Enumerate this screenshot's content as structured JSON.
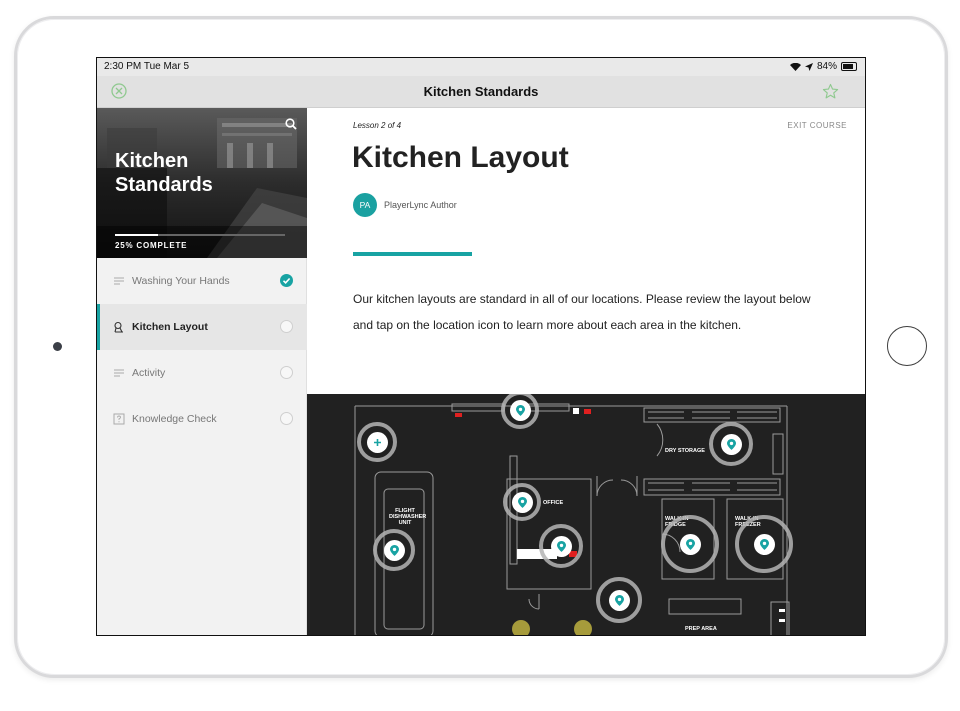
{
  "status_bar": {
    "time": "2:30 PM  Tue Mar 5",
    "battery": "84%"
  },
  "navbar": {
    "title": "Kitchen Standards",
    "close_icon": "close-circle-icon",
    "star_icon": "star-outline-icon"
  },
  "sidebar": {
    "course_title": "Kitchen Standards",
    "progress_label": "25% COMPLETE",
    "progress": 0.25,
    "items": [
      {
        "label": "Washing Your Hands",
        "icon": "lines-icon",
        "status": "complete"
      },
      {
        "label": "Kitchen Layout",
        "icon": "map-pin-icon",
        "status": "current"
      },
      {
        "label": "Activity",
        "icon": "lines-icon",
        "status": "incomplete"
      },
      {
        "label": "Knowledge Check",
        "icon": "question-box-icon",
        "status": "incomplete"
      }
    ]
  },
  "lesson": {
    "number": "Lesson 2 of 4",
    "exit": "EXIT COURSE",
    "title": "Kitchen Layout",
    "author_initials": "PA",
    "author": "PlayerLync Author",
    "body": "Our kitchen layouts are standard in all of our locations. Please review the layout below and tap on the location icon to learn more about each area in the kitchen."
  },
  "floorplan": {
    "labels": {
      "dry_storage": "DRY STORAGE",
      "office": "OFFICE",
      "flight_dishwasher": "FLIGHT DISHWASHER UNIT",
      "walkin_fridge": "WALK-IN FRIDGE",
      "walkin_freezer": "WALK-IN FREEZER",
      "prep_area": "PREP AREA"
    }
  },
  "colors": {
    "accent": "#18a3a3",
    "floorplan_bg": "#212121"
  }
}
